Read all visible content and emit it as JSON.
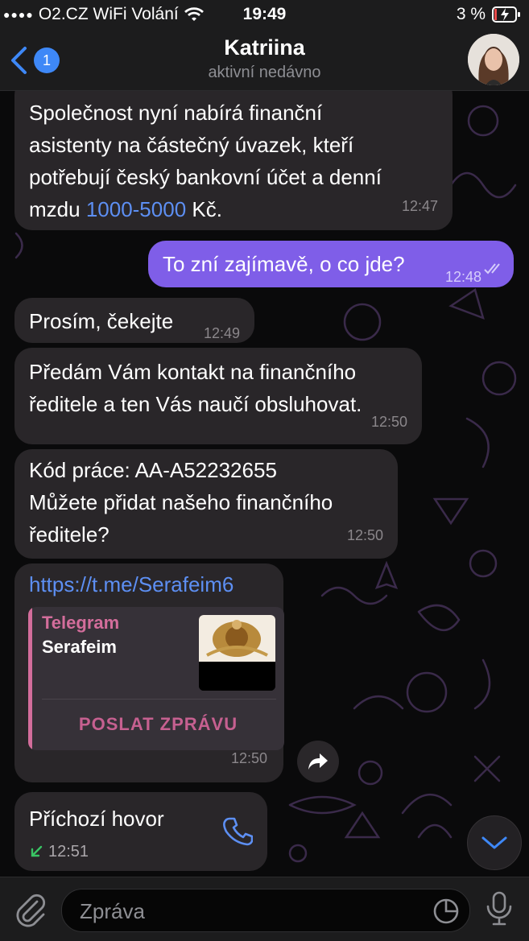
{
  "status_bar": {
    "carrier": "O2.CZ WiFi Volání",
    "time": "19:49",
    "battery": "3 %"
  },
  "header": {
    "back_badge": "1",
    "name": "Katriina",
    "status": "aktivní nedávno"
  },
  "messages": [
    {
      "text": "Společnost nyní nabírá finanční\nasistenty na částečný úvazek, kteří\npotřebují český bankovní účet a denní\nmzdu ",
      "highlight": "1000-5000",
      "text_after": " Kč.",
      "time": "12:47",
      "direction": "in"
    },
    {
      "text": "To zní zajímavě, o co jde?",
      "time": "12:48",
      "direction": "out"
    },
    {
      "text": "Prosím, čekejte",
      "time": "12:49",
      "direction": "in"
    },
    {
      "text": "Předám Vám kontakt na finančního\nředitele a ten Vás naučí obsluhovat.",
      "time": "12:50",
      "direction": "in"
    },
    {
      "text": "Kód práce: AA-A52232655\nMůžete přidat našeho finančního\nředitele?",
      "time": "12:50",
      "direction": "in"
    },
    {
      "link": "https://t.me/Serafeim6",
      "time": "12:50",
      "direction": "in",
      "preview": {
        "site": "Telegram",
        "name": "Serafeim",
        "button": "POSLAT ZPRÁVU"
      }
    },
    {
      "call_title": "Příchozí hovor",
      "time": "12:51",
      "direction": "in"
    }
  ],
  "input": {
    "placeholder": "Zpráva"
  },
  "colors": {
    "accent": "#3e88f7",
    "outgoing_bubble": "#7f5ee8",
    "incoming_bubble": "#292629",
    "link": "#5d8ff3",
    "preview_accent": "#d36d9b"
  }
}
